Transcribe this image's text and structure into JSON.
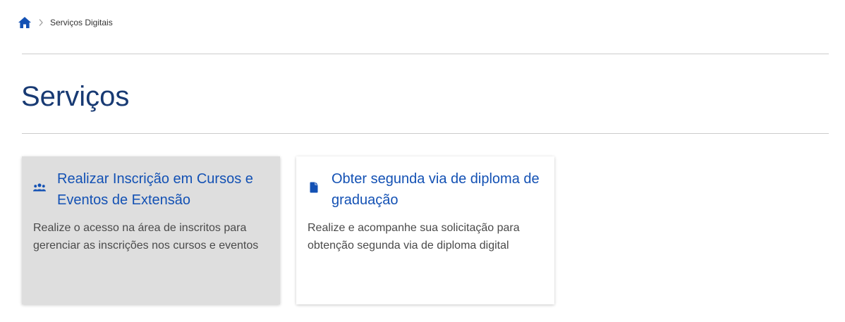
{
  "breadcrumb": {
    "home_icon": "home-icon",
    "separator_icon": "chevron-right-icon",
    "current": "Serviços Digitais"
  },
  "page": {
    "title": "Serviços"
  },
  "cards": [
    {
      "icon": "users-icon",
      "title": "Realizar Inscrição em Cursos e Eventos de Extensão",
      "description": "Realize o acesso na área de inscritos para gerenciar as inscrições nos cursos e eventos",
      "background": "#dedede"
    },
    {
      "icon": "document-icon",
      "title": "Obter segunda via de diploma de graduação",
      "description": "Realize e acompanhe sua solicitação para obtenção segunda via de diploma digital",
      "background": "#ffffff"
    }
  ],
  "colors": {
    "primary": "#1351b4",
    "title": "#183a73",
    "text": "#4a4a4a",
    "divider": "#cccccc"
  }
}
